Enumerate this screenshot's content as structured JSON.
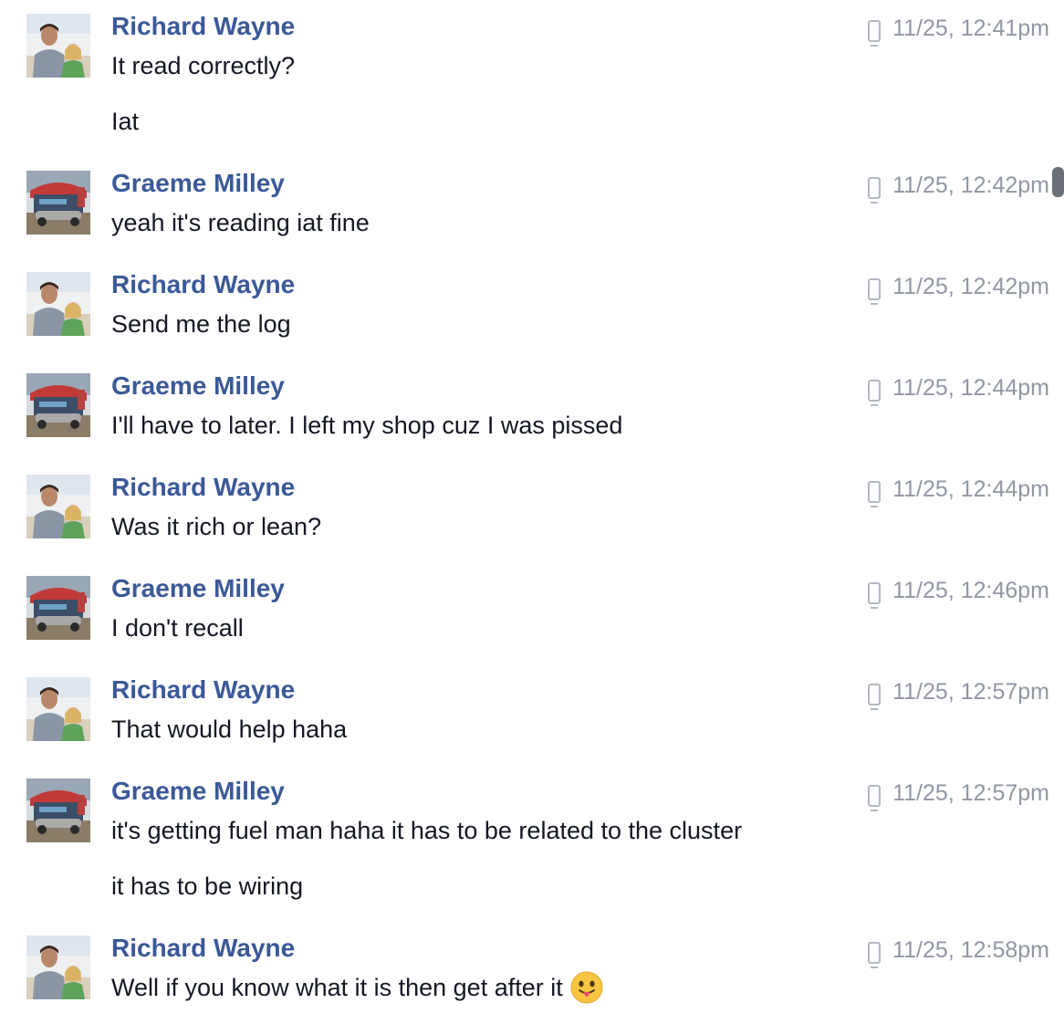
{
  "messages": [
    {
      "sender": "Richard Wayne",
      "avatar": "richard-avatar",
      "timestamp": "11/25, 12:41pm",
      "device_icon": "mobile-phone-icon",
      "lines": [
        "It read correctly?",
        "Iat"
      ]
    },
    {
      "sender": "Graeme Milley",
      "avatar": "graeme-avatar",
      "timestamp": "11/25, 12:42pm",
      "device_icon": "mobile-phone-icon",
      "lines": [
        "yeah it's reading iat fine"
      ]
    },
    {
      "sender": "Richard Wayne",
      "avatar": "richard-avatar",
      "timestamp": "11/25, 12:42pm",
      "device_icon": "mobile-phone-icon",
      "lines": [
        "Send me the log"
      ]
    },
    {
      "sender": "Graeme Milley",
      "avatar": "graeme-avatar",
      "timestamp": "11/25, 12:44pm",
      "device_icon": "mobile-phone-icon",
      "lines": [
        "I'll have to later. I left my shop cuz I was pissed"
      ]
    },
    {
      "sender": "Richard Wayne",
      "avatar": "richard-avatar",
      "timestamp": "11/25, 12:44pm",
      "device_icon": "mobile-phone-icon",
      "lines": [
        "Was it rich or lean?"
      ]
    },
    {
      "sender": "Graeme Milley",
      "avatar": "graeme-avatar",
      "timestamp": "11/25, 12:46pm",
      "device_icon": "mobile-phone-icon",
      "lines": [
        "I don't recall"
      ]
    },
    {
      "sender": "Richard Wayne",
      "avatar": "richard-avatar",
      "timestamp": "11/25, 12:57pm",
      "device_icon": "mobile-phone-icon",
      "lines": [
        "That would help haha"
      ]
    },
    {
      "sender": "Graeme Milley",
      "avatar": "graeme-avatar",
      "timestamp": "11/25, 12:57pm",
      "device_icon": "mobile-phone-icon",
      "lines": [
        "it's getting fuel man haha it has to be related to the cluster",
        "it has to be wiring"
      ]
    },
    {
      "sender": "Richard Wayne",
      "avatar": "richard-avatar",
      "timestamp": "11/25, 12:58pm",
      "device_icon": "mobile-phone-icon",
      "lines": [
        "Well if you know what it is then get after it"
      ],
      "trailing_emoji": "tongue-out-emoji-icon"
    }
  ],
  "colors": {
    "sender_name": "#3b5998",
    "message_text": "#141823",
    "timestamp": "#9197a3",
    "device_icon": "#b3b9c4",
    "scrollbar_thumb": "#6b6f76"
  }
}
